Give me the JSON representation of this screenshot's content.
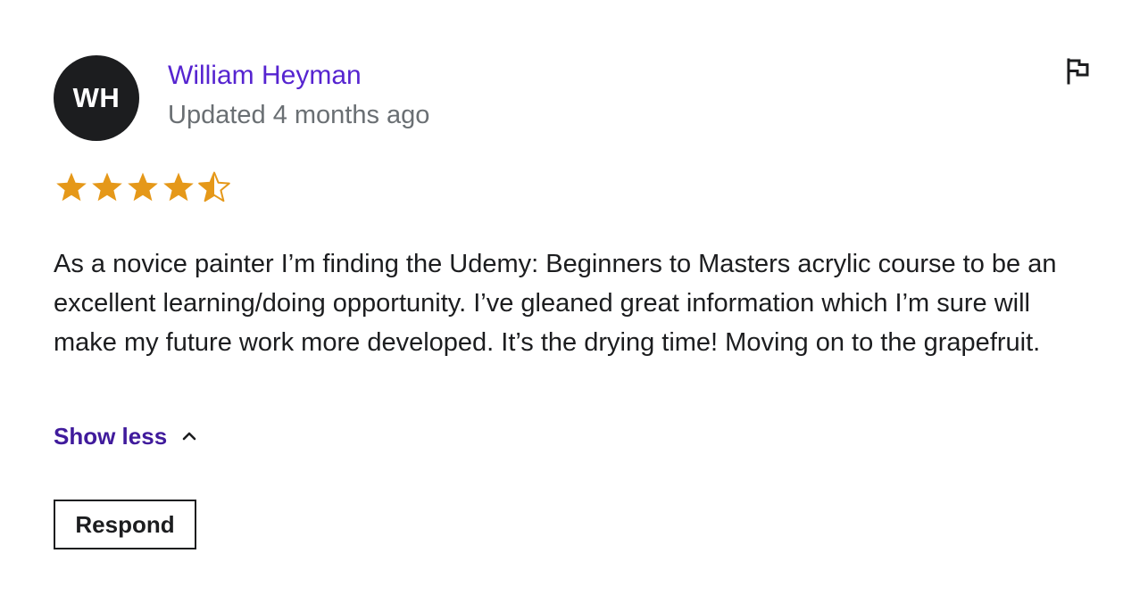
{
  "review": {
    "avatar_initials": "WH",
    "reviewer_name": "William Heyman",
    "updated_label": "Updated 4 months ago",
    "rating": 4.5,
    "rating_max": 5,
    "body": "As a novice painter I’m finding the Udemy: Beginners to Masters acrylic course to be an excellent learning/doing opportunity. I’ve gleaned great information which I’m sure will make my future work more developed. It’s the drying time! Moving on to the grapefruit.",
    "toggle_label": "Show less",
    "respond_label": "Respond"
  },
  "icons": {
    "report": "flag-icon",
    "star_filled": "star-filled-icon",
    "star_half": "star-half-icon",
    "toggle": "chevron-up-icon"
  },
  "colors": {
    "reviewer_name": "#5624d0",
    "link": "#401b9c",
    "star": "#e59819",
    "text": "#1c1d1f",
    "muted": "#6a6f73"
  }
}
